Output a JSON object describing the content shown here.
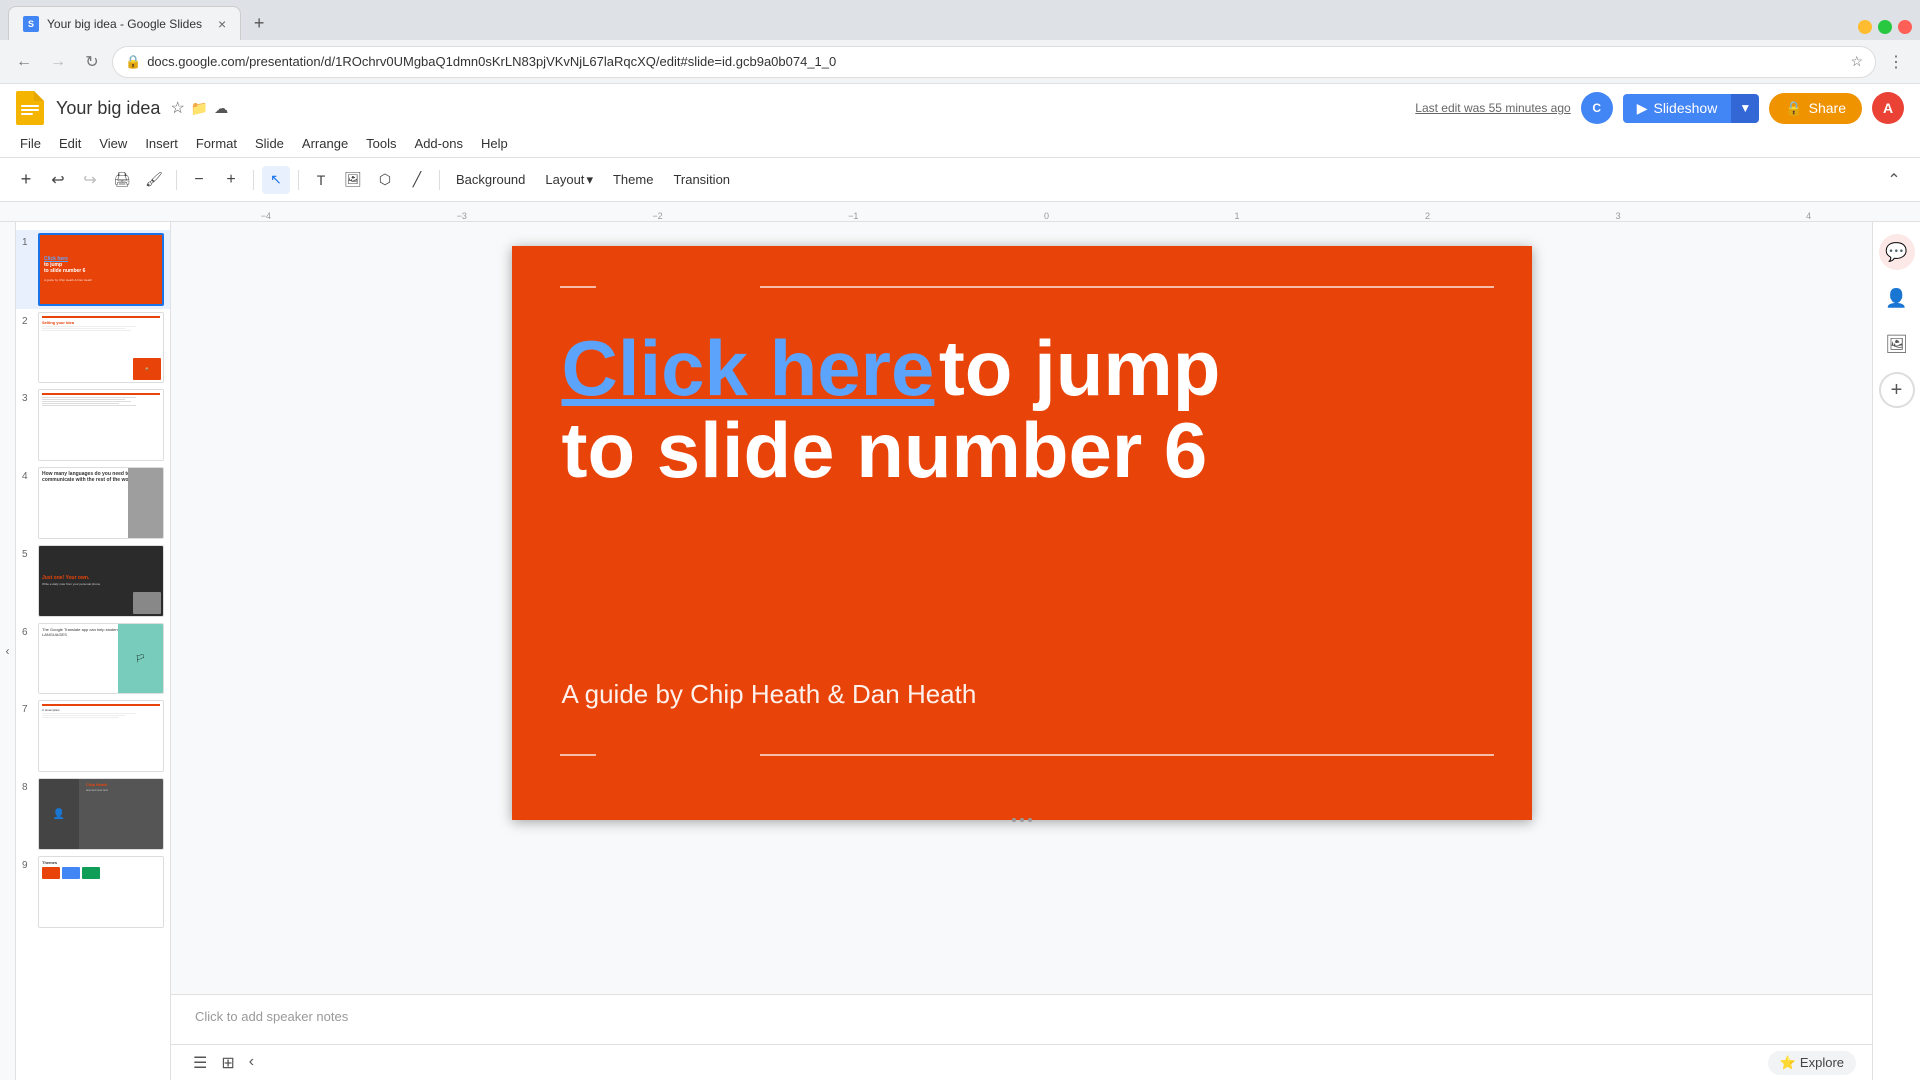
{
  "browser": {
    "tab_title": "Your big idea - Google Slides",
    "url": "docs.google.com/presentation/d/1ROchrv0UMgbaQ1dmn0sKrLN83pjVKvNjL67laRqcXQ/edit#slide=id.gcb9a0b074_1_0",
    "new_tab_label": "+"
  },
  "app": {
    "title": "Your big idea",
    "logo_letter": "S",
    "last_edit": "Last edit was 55 minutes ago",
    "slideshow_label": "Slideshow",
    "share_label": "Share",
    "profile_letter": "A"
  },
  "menu": {
    "items": [
      "File",
      "Edit",
      "View",
      "Insert",
      "Format",
      "Slide",
      "Arrange",
      "Tools",
      "Add-ons",
      "Help"
    ]
  },
  "toolbar": {
    "background_label": "Background",
    "layout_label": "Layout",
    "theme_label": "Theme",
    "transition_label": "Transition"
  },
  "slide": {
    "main_text_link": "Click here",
    "main_text_rest": " to jump",
    "main_text_line2": "to slide number 6",
    "subtitle": "A guide by Chip Heath & Dan Heath"
  },
  "speaker_notes": {
    "placeholder": "Click to add speaker notes"
  },
  "bottom": {
    "explore_label": "Explore"
  },
  "thumbnails": [
    {
      "num": "1",
      "active": true
    },
    {
      "num": "2",
      "active": false
    },
    {
      "num": "3",
      "active": false
    },
    {
      "num": "4",
      "active": false
    },
    {
      "num": "5",
      "active": false
    },
    {
      "num": "6",
      "active": false
    },
    {
      "num": "7",
      "active": false
    },
    {
      "num": "8",
      "active": false
    },
    {
      "num": "9",
      "active": false
    }
  ],
  "right_panel": {
    "icons": [
      "chat",
      "person",
      "photo",
      "add"
    ]
  }
}
